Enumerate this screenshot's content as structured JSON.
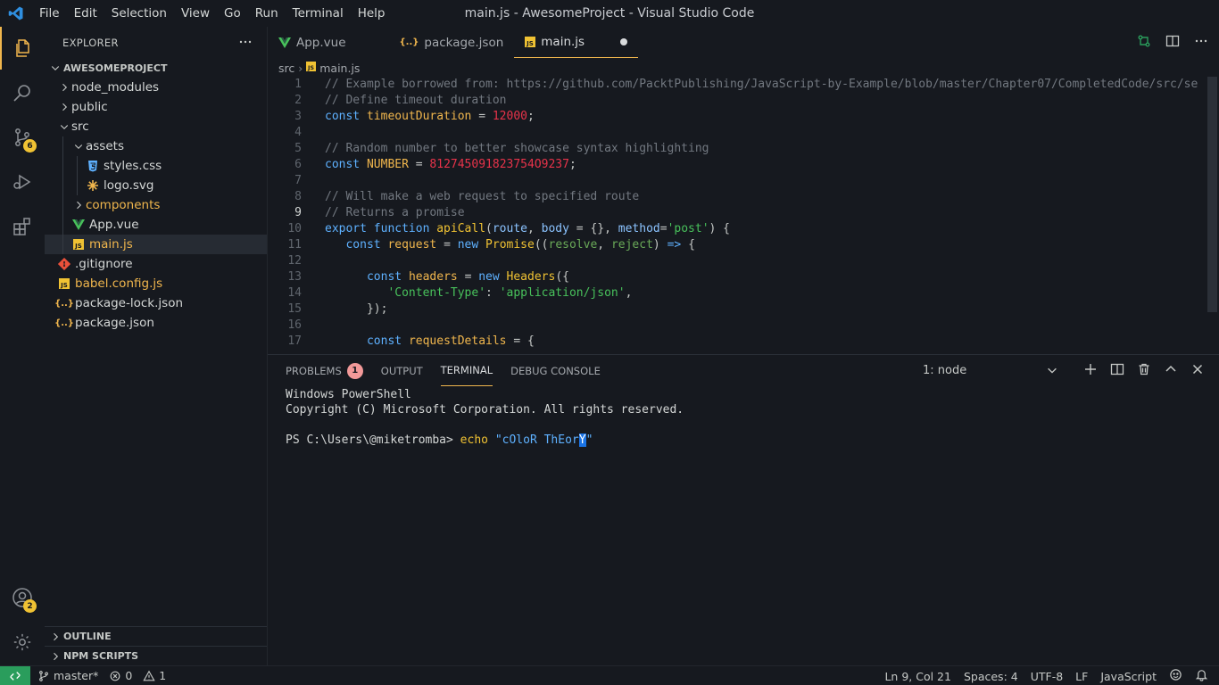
{
  "titlebar": {
    "menus": [
      "File",
      "Edit",
      "Selection",
      "View",
      "Go",
      "Run",
      "Terminal",
      "Help"
    ],
    "window_title": "main.js - AwesomeProject - Visual Studio Code"
  },
  "activitybar": {
    "source_control_badge": "6",
    "accounts_badge": "2"
  },
  "sidebar": {
    "title": "EXPLORER",
    "project": "AWESOMEPROJECT",
    "tree": [
      {
        "label": "node_modules",
        "type": "folder",
        "depth": 0,
        "expanded": false
      },
      {
        "label": "public",
        "type": "folder",
        "depth": 0,
        "expanded": false
      },
      {
        "label": "src",
        "type": "folder",
        "depth": 0,
        "expanded": true
      },
      {
        "label": "assets",
        "type": "folder",
        "depth": 1,
        "expanded": true
      },
      {
        "label": "styles.css",
        "type": "css",
        "depth": 2
      },
      {
        "label": "logo.svg",
        "type": "svg",
        "depth": 2
      },
      {
        "label": "components",
        "type": "folder",
        "depth": 1,
        "expanded": false
      },
      {
        "label": "App.vue",
        "type": "vue",
        "depth": 1
      },
      {
        "label": "main.js",
        "type": "js",
        "depth": 1,
        "selected": true
      },
      {
        "label": ".gitignore",
        "type": "git",
        "depth": 0
      },
      {
        "label": "babel.config.js",
        "type": "js",
        "depth": 0
      },
      {
        "label": "package-lock.json",
        "type": "json",
        "depth": 0
      },
      {
        "label": "package.json",
        "type": "json",
        "depth": 0
      }
    ],
    "outline": "OUTLINE",
    "npm_scripts": "NPM SCRIPTS"
  },
  "editor": {
    "tabs": [
      {
        "label": "App.vue",
        "icon": "vue"
      },
      {
        "label": "package.json",
        "icon": "json"
      },
      {
        "label": "main.js",
        "icon": "js",
        "active": true,
        "dirty": true
      }
    ],
    "breadcrumb": [
      "src",
      "main.js"
    ],
    "line_numbers": [
      "1",
      "2",
      "3",
      "4",
      "5",
      "6",
      "7",
      "8",
      "9",
      "10",
      "11",
      "12",
      "13",
      "14",
      "15",
      "16",
      "17"
    ],
    "current_line": 9
  },
  "panel": {
    "tabs": [
      "PROBLEMS",
      "OUTPUT",
      "TERMINAL",
      "DEBUG CONSOLE"
    ],
    "problems_count": "1",
    "active_tab": "TERMINAL",
    "terminal_select": "1: node",
    "terminal_lines": [
      "Windows PowerShell",
      "Copyright (C) Microsoft Corporation. All rights reserved.",
      ""
    ],
    "prompt": "PS C:\\Users\\@miketromba> ",
    "command": "echo",
    "argument_before_cursor": "\"cOloR ThEor",
    "argument_cursor": "Y",
    "argument_after_cursor": "\""
  },
  "statusbar": {
    "branch": "master*",
    "errors": "0",
    "warnings": "1",
    "position": "Ln 9, Col 21",
    "spaces": "Spaces: 4",
    "encoding": "UTF-8",
    "eol": "LF",
    "language": "JavaScript"
  },
  "colors": {
    "accent": "#f0b64d",
    "keyword": "#5eb1ff",
    "string": "#48c15b",
    "number": "#e8334a",
    "comment": "#727880"
  }
}
